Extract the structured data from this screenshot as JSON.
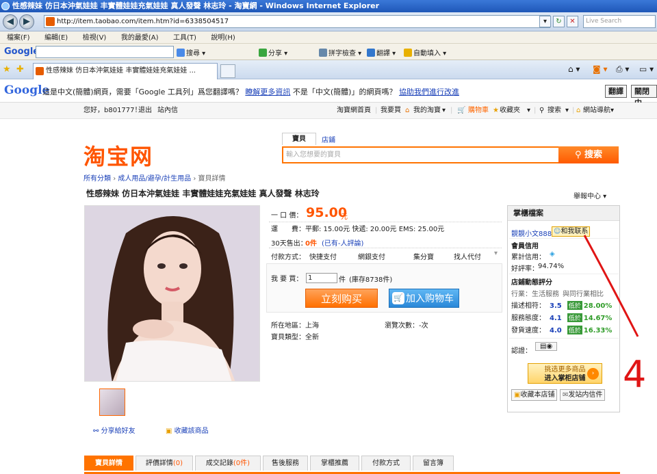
{
  "window": {
    "title": "性感辣妹 仿日本沖氣娃娃 丰實體娃娃充氣娃娃 真人發聲 林志玲 - 淘寶網 - Windows Internet Explorer"
  },
  "addressbar": {
    "url": "http://item.taobao.com/item.htm?id=6338504517",
    "search_placeholder": "Live Search"
  },
  "menubar": {
    "items": [
      "檔案(F)",
      "編輯(E)",
      "檢視(V)",
      "我的最愛(A)",
      "工具(T)",
      "說明(H)"
    ]
  },
  "google_toolbar": {
    "logo": "Google",
    "items": [
      "搜尋",
      "分享",
      "拼字檢查",
      "翻譯",
      "自動填入"
    ]
  },
  "tab": {
    "title": "性感辣妹 仿日本沖氣娃娃 丰實體娃娃充氣娃娃 ..."
  },
  "translate_bar": {
    "logo": "Google",
    "message": "這是中文(簡體)網頁，需要「Google 工具列」爲您翻譯嗎？",
    "more_link": "瞭解更多資訊",
    "not_lang": "不是「中文(簡體)」的網頁嗎？",
    "report_link": "協助我們進行改進",
    "translate_btn": "翻譯",
    "close_btn": "關閉中"
  },
  "topnav": {
    "greeting": "您好，b801777！",
    "logout": "退出",
    "inbox": "站內信",
    "home": "淘寶網首頁",
    "buy": "我要買",
    "my_taobao": "我的淘寶",
    "cart": "購物車",
    "favorites": "收藏夾",
    "search": "搜索",
    "site_nav": "網站導航"
  },
  "brand": {
    "logo_text": "淘宝网"
  },
  "search": {
    "tab_items": "寶貝",
    "tab_shops": "店鋪",
    "placeholder": "輸入您想要的寶貝",
    "button": "搜索"
  },
  "breadcrumb": [
    "所有分類",
    "成人用品/避孕/計生用品",
    "寶貝詳情"
  ],
  "product": {
    "title": "性感辣妹 仿日本沖氣娃娃 丰實體娃娃充氣娃娃 真人發聲 林志玲",
    "seller_center": "舉報中心",
    "price_label": "一 口 價：",
    "price": "95.00",
    "price_unit": "元",
    "shipping_label": "運　　費：",
    "shipping": "平郵: 15.00元 快遞: 20.00元 EMS: 25.00元",
    "sold_label": "30天售出：",
    "sold": "0件",
    "reviews": "(已有-人評論)",
    "payment_label": "付款方式：",
    "payments": [
      "快捷支付",
      "網銀支付",
      "集分寶",
      "找人代付"
    ],
    "qty_label": "我 要 買：",
    "qty": "1",
    "qty_unit": "件",
    "stock": "(庫存8738件)",
    "buy_now": "立刻购买",
    "add_cart": "加入购物车",
    "location_label": "所在地區：",
    "location": "上海",
    "views_label": "瀏覽次數：",
    "views": "-次",
    "type_label": "寶貝類型：",
    "type": "全新",
    "share": "分享給好友",
    "favorite": "收藏該商品"
  },
  "seller": {
    "header": "掌櫃檔案",
    "name": "靚靚小文888",
    "contact": "和我联系",
    "member_credit": "會員信用",
    "credit_label": "累計信用：",
    "positive_label": "好評率：",
    "positive_rate": "94.74%",
    "dynamic_score": "店鋪動態評分",
    "industry": "行業：生活服務",
    "compare": "與同行業相比",
    "scores": [
      {
        "label": "描述相符：",
        "score": "3.5",
        "tag": "低於",
        "diff": "28.00%"
      },
      {
        "label": "服務態度：",
        "score": "4.1",
        "tag": "低於",
        "diff": "14.67%"
      },
      {
        "label": "發貨速度：",
        "score": "4.0",
        "tag": "低於",
        "diff": "16.33%"
      }
    ],
    "cert_label": "認證：",
    "more_stores_1": "挑选更多商品",
    "more_stores_2": "进入掌柜店铺",
    "fav_store": "收藏本店铺",
    "send_msg": "发站内信件"
  },
  "annotation": {
    "number": "4",
    "color": "#e01515"
  },
  "bottom_tabs": [
    {
      "label": "寶貝詳情",
      "count": ""
    },
    {
      "label": "評價詳情",
      "count": "(0)"
    },
    {
      "label": "成交記錄",
      "count": "(0件)"
    },
    {
      "label": "售後服務",
      "count": ""
    },
    {
      "label": "掌櫃推薦",
      "count": ""
    },
    {
      "label": "付款方式",
      "count": ""
    },
    {
      "label": "留言簿",
      "count": ""
    }
  ],
  "colors": {
    "accent": "#ff5500",
    "link": "#1a40b8",
    "good": "#2f9c28"
  }
}
